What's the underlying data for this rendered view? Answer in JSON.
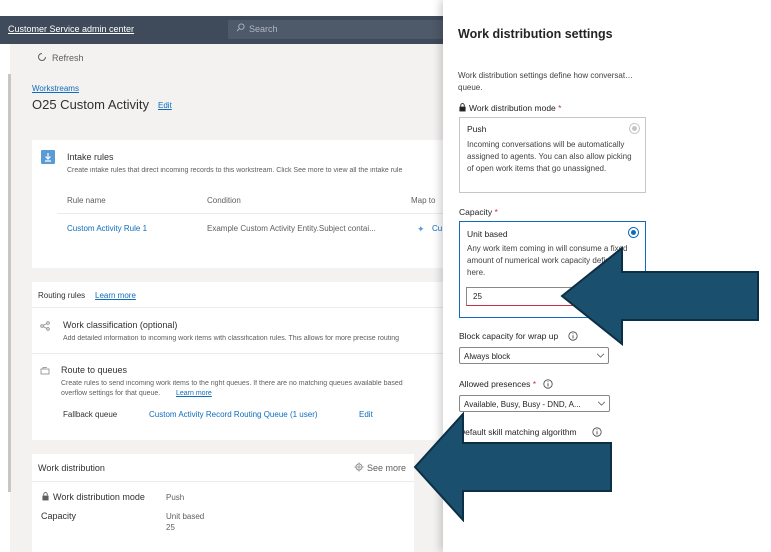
{
  "header": {
    "app_title": "Customer Service admin center",
    "search_placeholder": "Search"
  },
  "toolbar": {
    "refresh_label": "Refresh"
  },
  "breadcrumb": {
    "label": "Workstreams"
  },
  "page": {
    "title": "O25 Custom Activity",
    "edit_label": "Edit"
  },
  "intake": {
    "title": "Intake rules",
    "description": "Create intake rules that direct incoming records to this workstream. Click See more to view all the intake rule",
    "columns": [
      "Rule name",
      "Condition",
      "Map to"
    ],
    "rows": [
      {
        "name": "Custom Activity Rule 1",
        "condition": "Example Custom Activity Entity.Subject contai...",
        "map_to": "Cu"
      }
    ]
  },
  "routing": {
    "title": "Routing rules",
    "learn_more": "Learn more",
    "classification_title": "Work classification (optional)",
    "classification_desc": "Add detailed information to incoming work items with classification rules. This allows for more precise routing",
    "queues_title": "Route to queues",
    "queues_desc_1": "Create rules to send incoming work items to the right queues. If there are no matching queues available based",
    "queues_desc_2": "overflow settings for that queue.",
    "queues_learn_more": "Learn more",
    "fallback_label": "Fallback queue",
    "fallback_value": "Custom Activity Record Routing Queue (1 user)",
    "fallback_edit": "Edit"
  },
  "work_distribution_card": {
    "title": "Work distribution",
    "see_more": "See more",
    "mode_label": "Work distribution mode",
    "mode_value": "Push",
    "capacity_label": "Capacity",
    "capacity_value_1": "Unit based",
    "capacity_value_2": "25"
  },
  "panel": {
    "title": "Work distribution settings",
    "description": "Work distribution settings define how conversat… queue.",
    "mode_label": "Work distribution mode",
    "required_mark": "*",
    "push_title": "Push",
    "push_desc": "Incoming conversations will be automatically assigned to agents. You can also allow picking of open work items that go unassigned.",
    "capacity_label": "Capacity",
    "unit_title": "Unit based",
    "unit_desc": "Any work item coming in will consume a fixed amount of numerical work capacity defined here.",
    "capacity_value": "25",
    "block_label": "Block capacity for wrap up",
    "block_value": "Always block",
    "presences_label": "Allowed presences",
    "presences_value": "Available, Busy, Busy - DND, A...",
    "skill_label": "Default skill matching algorithm"
  },
  "colors": {
    "arrow": "#1a4f6e",
    "accent": "#0f6cbd",
    "topbar": "#3f4a5a"
  },
  "icons": [
    "search-icon",
    "refresh-icon",
    "download-icon",
    "share-icon",
    "queue-icon",
    "gear-icon",
    "lock-icon",
    "info-icon",
    "chevron-down-icon"
  ]
}
